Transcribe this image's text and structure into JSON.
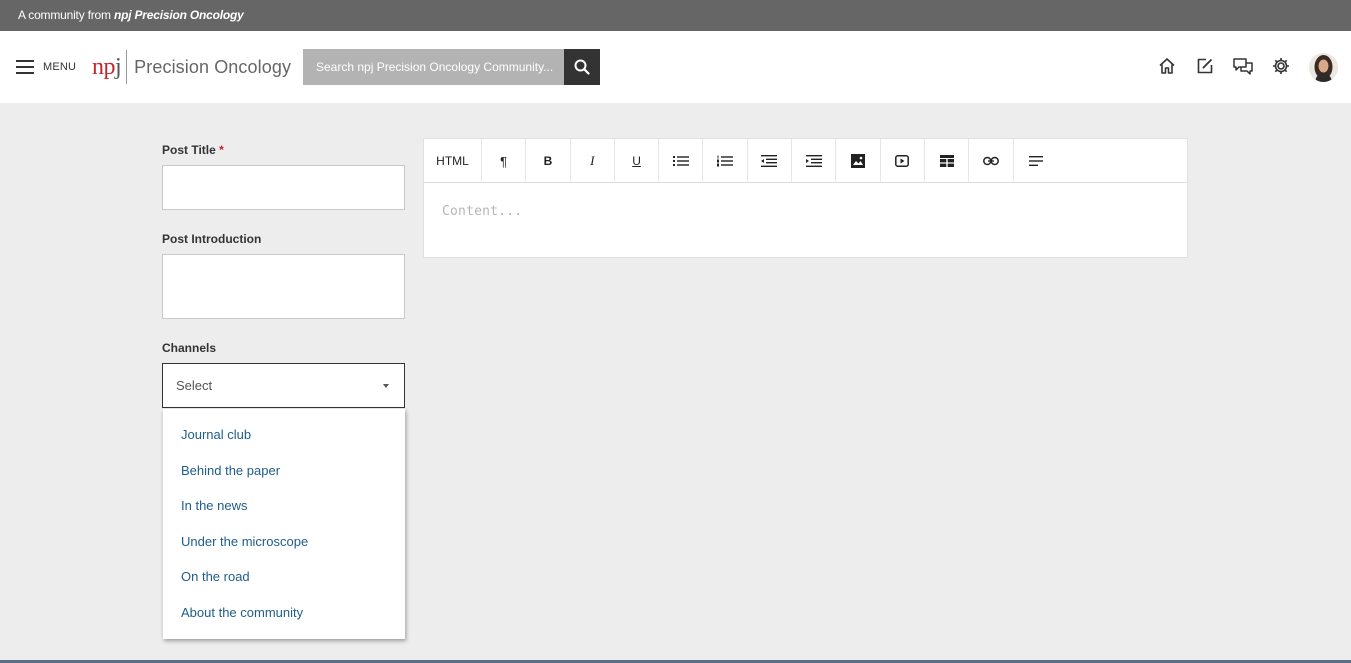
{
  "topstrip": {
    "prefix": "A community from ",
    "brand": "npj Precision Oncology"
  },
  "header": {
    "menu_label": "MENU",
    "logo_npj_a": "np",
    "logo_npj_b": "j",
    "logo_name": "Precision Oncology",
    "search_placeholder": "Search npj Precision Oncology Community...",
    "icons": [
      "home-icon",
      "new-post-icon",
      "chat-icon",
      "settings-icon"
    ]
  },
  "form": {
    "title_label": "Post Title",
    "required_mark": "*",
    "intro_label": "Post Introduction",
    "channels_label": "Channels",
    "select_value": "Select",
    "options": [
      "Journal club",
      "Behind the paper",
      "In the news",
      "Under the microscope",
      "On the road",
      "About the community"
    ]
  },
  "editor": {
    "html_button": "HTML",
    "paragraph_glyph": "¶",
    "bold_glyph": "B",
    "italic_glyph": "I",
    "underline_glyph": "U",
    "placeholder": "Content..."
  }
}
